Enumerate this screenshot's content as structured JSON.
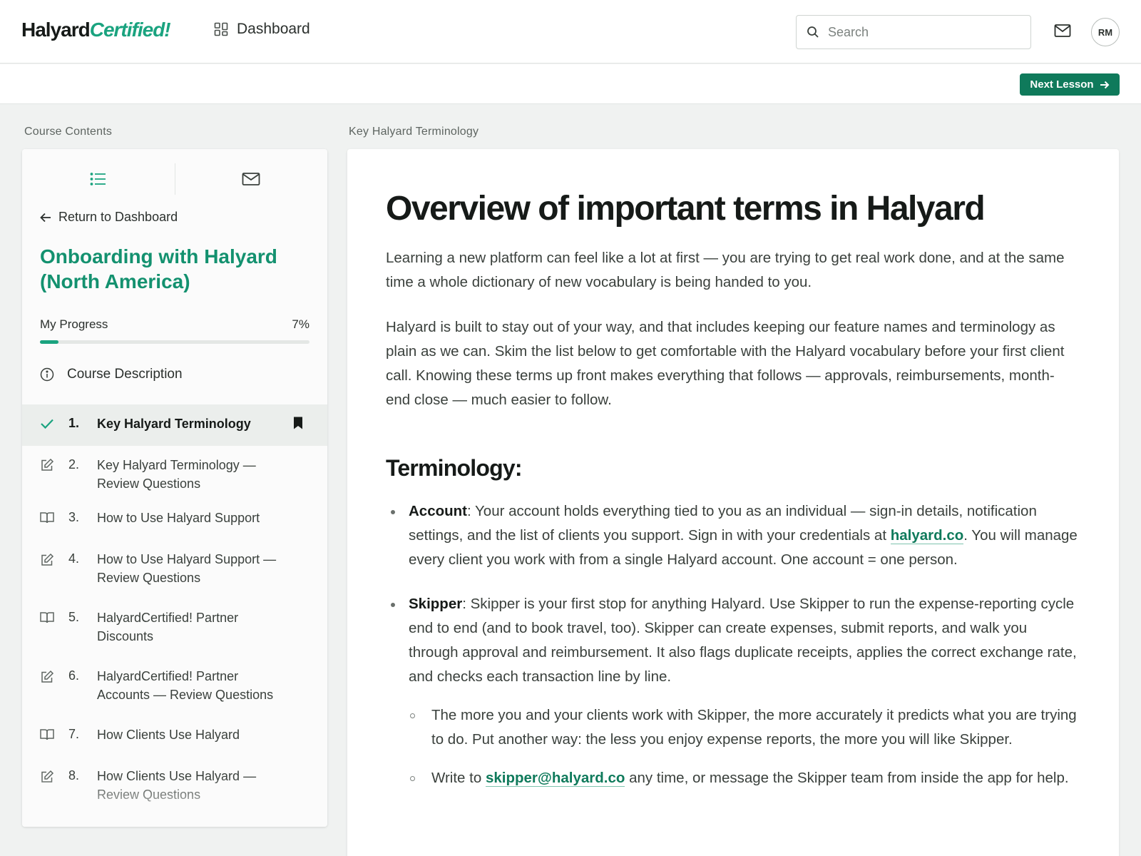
{
  "header": {
    "brand_part1": "Halyard",
    "brand_part2": "Certified!",
    "dashboard_label": "Dashboard",
    "search_placeholder": "Search",
    "avatar_initials": "RM"
  },
  "subbar": {
    "next_lesson_label": "Next Lesson"
  },
  "sidebar": {
    "section_label": "Course Contents",
    "return_label": "Return to Dashboard",
    "course_title": "Onboarding with Halyard (North America)",
    "progress_label": "My Progress",
    "progress_text": "7%",
    "progress_value": 7,
    "course_description_label": "Course Description",
    "lessons": [
      {
        "number": "1.",
        "title": "Key Halyard Terminology",
        "icon": "check-icon",
        "active": true
      },
      {
        "number": "2.",
        "title": "Key Halyard Terminology — Review Questions",
        "icon": "edit-icon"
      },
      {
        "number": "3.",
        "title": "How to Use Halyard Support",
        "icon": "book-icon"
      },
      {
        "number": "4.",
        "title": "How to Use Halyard Support — Review Questions",
        "icon": "edit-icon"
      },
      {
        "number": "5.",
        "title": "HalyardCertified! Partner Discounts",
        "icon": "book-icon"
      },
      {
        "number": "6.",
        "title": "HalyardCertified! Partner Accounts — Review Questions",
        "icon": "edit-icon"
      },
      {
        "number": "7.",
        "title": "How Clients Use Halyard",
        "icon": "book-icon"
      },
      {
        "number": "8.",
        "title": "How Clients Use Halyard — Review Questions",
        "icon": "edit-icon"
      }
    ]
  },
  "main": {
    "section_label": "Key Halyard Terminology",
    "title": "Overview of important terms in Halyard",
    "paragraph1": "Learning a new platform can feel like a lot at first — you are trying to get real work done, and at the same time a whole dictionary of new vocabulary is being handed to you.",
    "paragraph2": "Halyard is built to stay out of your way, and that includes keeping our feature names and terminology as plain as we can. Skim the list below to get comfortable with the Halyard vocabulary before your first client call. Knowing these terms up front makes everything that follows — approvals, reimbursements, month-end close — much easier to follow.",
    "terminology_heading": "Terminology:",
    "term_account_name": "Account",
    "term_account_text_a": ": Your account holds everything tied to you as an individual — sign-in details, notification settings, and the list of clients you support. Sign in with your credentials at ",
    "term_account_link": "halyard.co",
    "term_account_text_b": ". You will manage every client you work with from a single Halyard account. One account = one person.",
    "term_skipper_name": "Skipper",
    "term_skipper_text": ": Skipper is your first stop for anything Halyard. Use Skipper to run the expense-reporting cycle end to end (and to book travel, too). Skipper can create expenses, submit reports, and walk you through approval and reimbursement. It also flags duplicate receipts, applies the correct exchange rate, and checks each transaction line by line.",
    "skipper_sub1": "The more you and your clients work with Skipper, the more accurately it predicts what you are trying to do. Put another way: the less you enjoy expense reports, the more you will like Skipper.",
    "skipper_sub2_a": "Write to ",
    "skipper_sub2_link": "skipper@halyard.co",
    "skipper_sub2_b": " any time, or message the Skipper team from inside the app for help."
  },
  "colors": {
    "accent": "#1aa37f",
    "accent_dark": "#0f7a5b"
  }
}
